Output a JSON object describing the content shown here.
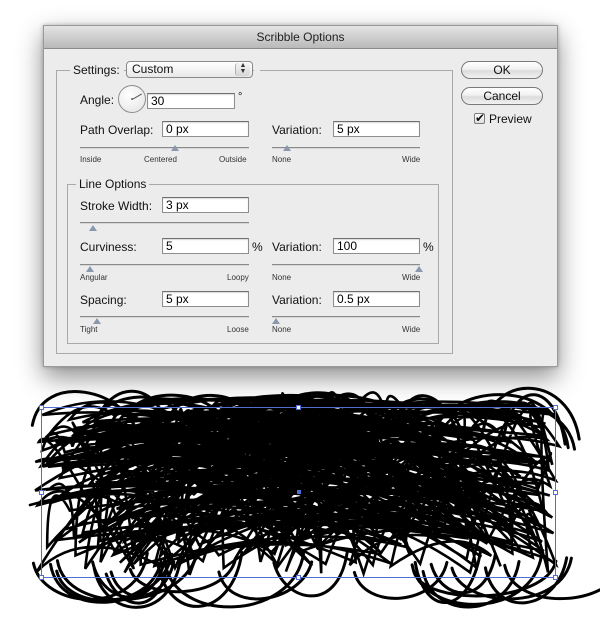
{
  "dialog": {
    "title": "Scribble Options",
    "settings": {
      "label": "Settings:",
      "selected": "Custom"
    },
    "angle": {
      "label": "Angle:",
      "value": "30",
      "unit": "°",
      "degrees": 30
    },
    "path_overlap": {
      "label": "Path Overlap:",
      "value": "0 px",
      "slider": {
        "position": 0.5,
        "ticks": [
          "Inside",
          "Centered",
          "Outside"
        ]
      },
      "variation": {
        "label": "Variation:",
        "value": "5 px",
        "slider": {
          "position": 0.05,
          "ticks": [
            "None",
            "Wide"
          ]
        }
      }
    },
    "line_options": {
      "legend": "Line Options",
      "stroke_width": {
        "label": "Stroke Width:",
        "value": "3 px",
        "slider": {
          "position": 0.05
        }
      },
      "curviness": {
        "label": "Curviness:",
        "value": "5",
        "unit": "%",
        "slider": {
          "position": 0.05,
          "ticks": [
            "Angular",
            "Loopy"
          ]
        },
        "variation": {
          "label": "Variation:",
          "value": "100",
          "unit": "%",
          "slider": {
            "position": 1.0,
            "ticks": [
              "None",
              "Wide"
            ]
          }
        }
      },
      "spacing": {
        "label": "Spacing:",
        "value": "5 px",
        "slider": {
          "position": 0.1,
          "ticks": [
            "Tight",
            "Loose"
          ]
        },
        "variation": {
          "label": "Variation:",
          "value": "0.5 px",
          "slider": {
            "position": 0.02,
            "ticks": [
              "None",
              "Wide"
            ]
          }
        }
      }
    },
    "buttons": {
      "ok": "OK",
      "cancel": "Cancel"
    },
    "preview": {
      "label": "Preview",
      "checked": true,
      "check_glyph": "✔"
    },
    "select_arrows_glyph": "▲▼"
  },
  "canvas": {
    "scribble_color": "#000000",
    "selection_color": "#4f6fd6"
  }
}
